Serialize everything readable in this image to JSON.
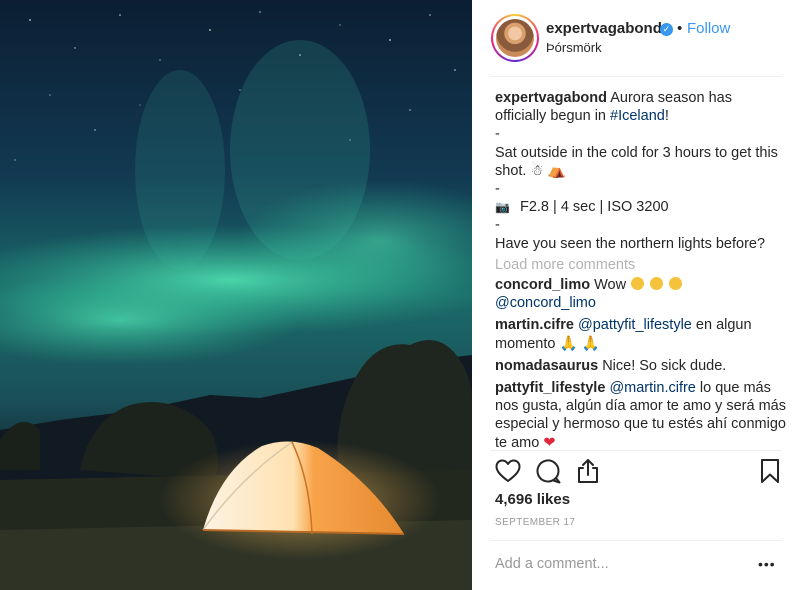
{
  "post": {
    "username": "expertvagabond",
    "verified_icon": "verified-badge-icon",
    "separator": "•",
    "follow_label": "Follow",
    "location": "Þórsmörk",
    "accent_color": "#3897f0"
  },
  "caption": {
    "username": "expertvagabond",
    "text_1": "Aurora season has officially begun in",
    "hashtag": "#Iceland",
    "text_1_end": "!",
    "dash_1": "-",
    "text_2": "Sat outside in the cold for 3 hours to get this shot.",
    "dash_2": "-",
    "camera_icon": "camera-icon",
    "settings": "F2.8 | 4 sec | ISO 3200",
    "dash_3": "-",
    "text_3": "Have you seen the northern lights before?"
  },
  "load_more_label": "Load more comments",
  "comments": [
    {
      "user": "concord_limo",
      "text": "Wow",
      "mention": "@concord_limo"
    },
    {
      "user": "martin.cifre",
      "mention": "@pattyfit_lifestyle",
      "text": "en algun momento"
    },
    {
      "user": "nomadasaurus",
      "text": "Nice! So sick dude."
    },
    {
      "user": "pattyfit_lifestyle",
      "mention": "@martin.cifre",
      "text": "lo que más nos gusta, algún día amor te amo y será más especial y hermoso que tu estés ahí conmigo te amo",
      "heart": "❤"
    }
  ],
  "likes_label": "4,696 likes",
  "date_label": "SEPTEMBER 17",
  "add_comment_placeholder": "Add a comment...",
  "more_label": "•••"
}
